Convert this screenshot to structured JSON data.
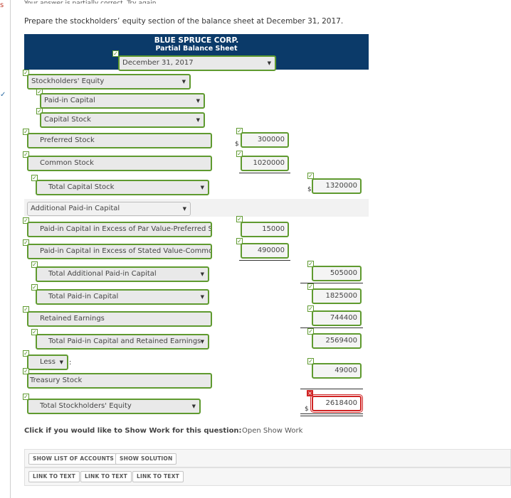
{
  "edge": {
    "s": "s",
    "tick": "✓",
    "top_cut": "Your answer is partially correct.  Try again."
  },
  "prompt": "Prepare the stockholders’ equity section of the balance sheet at December 31, 2017.",
  "header": {
    "company": "BLUE SPRUCE CORP.",
    "subtitle": "Partial Balance Sheet",
    "date": "December 31, 2017"
  },
  "rows": {
    "stockholders_equity": "Stockholders' Equity",
    "paid_in_capital": "Paid-in Capital",
    "capital_stock": "Capital Stock",
    "preferred_stock": {
      "label": "Preferred Stock",
      "value": "300000"
    },
    "common_stock": {
      "label": "Common Stock",
      "value": "1020000"
    },
    "total_capital_stock": {
      "label": "Total Capital Stock",
      "value": "1320000"
    },
    "additional_pic": "Additional Paid-in Capital",
    "pic_preferred": {
      "label": "Paid-in Capital in Excess of Par Value-Preferred St",
      "value": "15000"
    },
    "pic_common": {
      "label": "Paid-in Capital in Excess of Stated Value-Common",
      "value": "490000"
    },
    "total_additional_pic": {
      "label": "Total Additional Paid-in Capital",
      "value": "505000"
    },
    "total_pic": {
      "label": "Total Paid-in Capital",
      "value": "1825000"
    },
    "retained_earnings": {
      "label": "Retained Earnings",
      "value": "744400"
    },
    "total_pic_re": {
      "label": "Total Paid-in Capital and Retained Earnings",
      "value": "2569400"
    },
    "less": {
      "label": "Less",
      "colon": ":"
    },
    "treasury_stock": {
      "label": "Treasury Stock",
      "value": "49000"
    },
    "total_se": {
      "label": "Total Stockholders' Equity",
      "value": "2618400"
    }
  },
  "dollar_sign": "$",
  "show_work": {
    "prompt": "Click if you would like to Show Work for this question:",
    "link": "Open Show Work"
  },
  "buttons": {
    "show_list": "SHOW LIST OF ACCOUNTS",
    "show_solution": "SHOW SOLUTION",
    "link1": "LINK TO TEXT",
    "link2": "LINK TO TEXT",
    "link3": "LINK TO TEXT"
  },
  "colors": {
    "header_bg": "#0b3a69",
    "correct_border": "#5f9a2f",
    "error_border": "#d02525"
  }
}
